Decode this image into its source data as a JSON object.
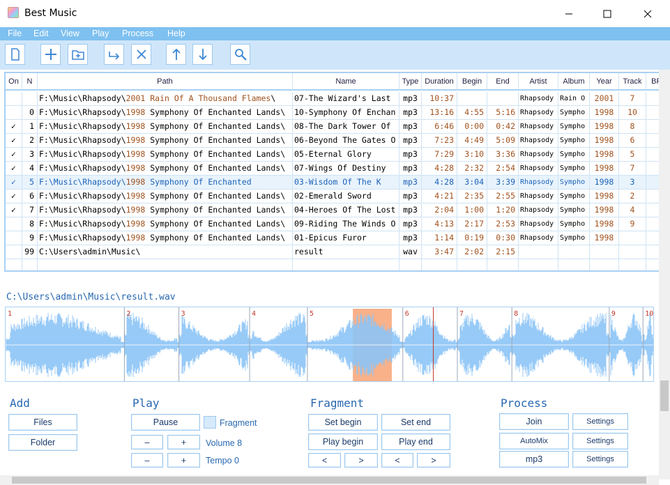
{
  "window": {
    "title": "Best Music",
    "min": "—",
    "max": "☐",
    "close": "✕"
  },
  "menu": [
    "File",
    "Edit",
    "View",
    "Play",
    "Process",
    "Help"
  ],
  "toolbar": [
    "new-icon",
    "add-icon",
    "add-folder-icon",
    "move-icon",
    "delete-icon",
    "up-icon",
    "down-icon",
    "search-icon"
  ],
  "grid": {
    "columns": [
      "On",
      "N",
      "Path",
      "Name",
      "Type",
      "Duration",
      "Begin",
      "End",
      "Artist",
      "Album",
      "Year",
      "Track",
      "BP"
    ],
    "rows": [
      {
        "on": "",
        "n": "",
        "drive": "F:\\Music\\Rhapsody\\",
        "folder": "2001 Rain Of A Thousand Flames",
        "tail": "\\",
        "name": "07-The Wizard's Last",
        "type": "mp3",
        "duration": "10:37",
        "begin": "",
        "end": "",
        "artist": "Rhapsody",
        "album": "Rain O",
        "year": "2001",
        "track": "7"
      },
      {
        "on": "",
        "n": "0",
        "drive": "F:\\Music\\Rhapsody\\",
        "folder": "1998",
        "tail": " Symphony Of Enchanted Lands\\",
        "name": "10-Symphony Of Enchan",
        "type": "mp3",
        "duration": "13:16",
        "begin": "4:55",
        "end": "5:16",
        "artist": "Rhapsody",
        "album": "Sympho",
        "year": "1998",
        "track": "10"
      },
      {
        "on": "✓",
        "n": "1",
        "drive": "F:\\Music\\Rhapsody\\",
        "folder": "1998",
        "tail": " Symphony Of Enchanted Lands\\",
        "name": "08-The Dark Tower Of",
        "type": "mp3",
        "duration": "6:46",
        "begin": "0:00",
        "end": "0:42",
        "artist": "Rhapsody",
        "album": "Sympho",
        "year": "1998",
        "track": "8"
      },
      {
        "on": "✓",
        "n": "2",
        "drive": "F:\\Music\\Rhapsody\\",
        "folder": "1998",
        "tail": " Symphony Of Enchanted Lands\\",
        "name": "06-Beyond The Gates O",
        "type": "mp3",
        "duration": "7:23",
        "begin": "4:49",
        "end": "5:09",
        "artist": "Rhapsody",
        "album": "Sympho",
        "year": "1998",
        "track": "6"
      },
      {
        "on": "✓",
        "n": "3",
        "drive": "F:\\Music\\Rhapsody\\",
        "folder": "1998",
        "tail": " Symphony Of Enchanted Lands\\",
        "name": "05-Eternal Glory",
        "type": "mp3",
        "duration": "7:29",
        "begin": "3:10",
        "end": "3:36",
        "artist": "Rhapsody",
        "album": "Sympho",
        "year": "1998",
        "track": "5"
      },
      {
        "on": "✓",
        "n": "4",
        "drive": "F:\\Music\\Rhapsody\\",
        "folder": "1998",
        "tail": " Symphony Of Enchanted Lands\\",
        "name": "07-Wings Of Destiny",
        "type": "mp3",
        "duration": "4:28",
        "begin": "2:32",
        "end": "2:54",
        "artist": "Rhapsody",
        "album": "Sympho",
        "year": "1998",
        "track": "7"
      },
      {
        "on": "✓",
        "n": "5",
        "drive": "F:\\Music\\Rhapsody\\",
        "folder": "1998",
        "tail": " Symphony Of Enchanted",
        "name": "03-Wisdom Of The K",
        "type": "mp3",
        "duration": "4:28",
        "begin": "3:04",
        "end": "3:39",
        "artist": "Rhapsody",
        "album": "Sympho",
        "year": "1998",
        "track": "3",
        "selected": true
      },
      {
        "on": "✓",
        "n": "6",
        "drive": "F:\\Music\\Rhapsody\\",
        "folder": "1998",
        "tail": " Symphony Of Enchanted Lands\\",
        "name": "02-Emerald Sword",
        "type": "mp3",
        "duration": "4:21",
        "begin": "2:35",
        "end": "2:55",
        "artist": "Rhapsody",
        "album": "Sympho",
        "year": "1998",
        "track": "2"
      },
      {
        "on": "✓",
        "n": "7",
        "drive": "F:\\Music\\Rhapsody\\",
        "folder": "1998",
        "tail": " Symphony Of Enchanted Lands\\",
        "name": "04-Heroes Of The Lost",
        "type": "mp3",
        "duration": "2:04",
        "begin": "1:00",
        "end": "1:20",
        "artist": "Rhapsody",
        "album": "Sympho",
        "year": "1998",
        "track": "4"
      },
      {
        "on": "",
        "n": "8",
        "drive": "F:\\Music\\Rhapsody\\",
        "folder": "1998",
        "tail": " Symphony Of Enchanted Lands\\",
        "name": "09-Riding The Winds O",
        "type": "mp3",
        "duration": "4:13",
        "begin": "2:17",
        "end": "2:53",
        "artist": "Rhapsody",
        "album": "Sympho",
        "year": "1998",
        "track": "9"
      },
      {
        "on": "",
        "n": "9",
        "drive": "F:\\Music\\Rhapsody\\",
        "folder": "1998",
        "tail": " Symphony Of Enchanted Lands\\",
        "name": "01-Epicus Furor",
        "type": "mp3",
        "duration": "1:14",
        "begin": "0:19",
        "end": "0:30",
        "artist": "Rhapsody",
        "album": "Sympho",
        "year": "1998",
        "track": ""
      },
      {
        "on": "",
        "n": "99",
        "drive": "C:\\Users\\admin\\Music\\",
        "folder": "",
        "tail": "",
        "name": "result",
        "type": "wav",
        "duration": "3:47",
        "begin": "2:02",
        "end": "2:15",
        "artist": "",
        "album": "",
        "year": "",
        "track": ""
      }
    ]
  },
  "waveform": {
    "file_path": "C:\\Users\\admin\\Music\\result.wav",
    "segment_labels": [
      "1",
      "2",
      "3",
      "4",
      "5",
      "6",
      "7",
      "8",
      "9",
      "10"
    ],
    "segment_bounds": [
      0.0,
      0.183,
      0.267,
      0.376,
      0.465,
      0.612,
      0.696,
      0.78,
      0.93,
      0.982,
      1.0
    ],
    "fragment": [
      0.535,
      0.595
    ],
    "cursor": 0.659,
    "colors": {
      "wave": "#8cc4f6",
      "fragment": "#f9b189",
      "cursor": "#c0392b"
    }
  },
  "add": {
    "title": "Add",
    "files": "Files",
    "folder": "Folder"
  },
  "play": {
    "title": "Play",
    "pause": "Pause",
    "fragment": "Fragment",
    "minus": "–",
    "plus": "+",
    "volume": "Volume 8",
    "tempo": "Tempo 0"
  },
  "fragment": {
    "title": "Fragment",
    "set_begin": "Set begin",
    "set_end": "Set end",
    "play_begin": "Play begin",
    "play_end": "Play end",
    "prev": "<",
    "next": ">"
  },
  "process": {
    "title": "Process",
    "join": "Join",
    "automix": "AutoMix",
    "mp3": "mp3",
    "settings": "Settings"
  }
}
